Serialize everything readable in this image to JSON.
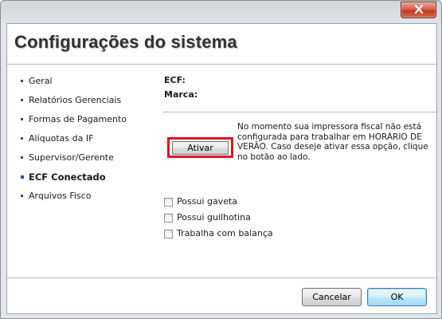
{
  "window": {
    "close_icon": "close-x-icon"
  },
  "header": {
    "title": "Configurações do sistema"
  },
  "sidebar": {
    "items": [
      {
        "label": "Geral",
        "active": false
      },
      {
        "label": "Relatórios Gerenciais",
        "active": false
      },
      {
        "label": "Formas de Pagamento",
        "active": false
      },
      {
        "label": "Alíquotas da IF",
        "active": false
      },
      {
        "label": "Supervisor/Gerente",
        "active": false
      },
      {
        "label": "ECF Conectado",
        "active": true
      },
      {
        "label": "Arquivos Fisco",
        "active": false
      }
    ]
  },
  "ecf": {
    "ecf_label": "ECF:",
    "ecf_value": "",
    "brand_label": "Marca:",
    "brand_value": "",
    "activate_label": "Ativar",
    "dst_message": "No momento sua impressora fiscal não está configurada para trabalhar em HORÁRIO DE VERÃO. Caso deseje ativar essa opção, clique no botão ao lado.",
    "highlight_color": "#e0141e"
  },
  "options": [
    {
      "label": "Possui gaveta",
      "checked": false
    },
    {
      "label": "Possui guilhotina",
      "checked": false
    },
    {
      "label": "Trabalha com balança",
      "checked": false
    }
  ],
  "footer": {
    "cancel_label": "Cancelar",
    "ok_label": "OK"
  }
}
